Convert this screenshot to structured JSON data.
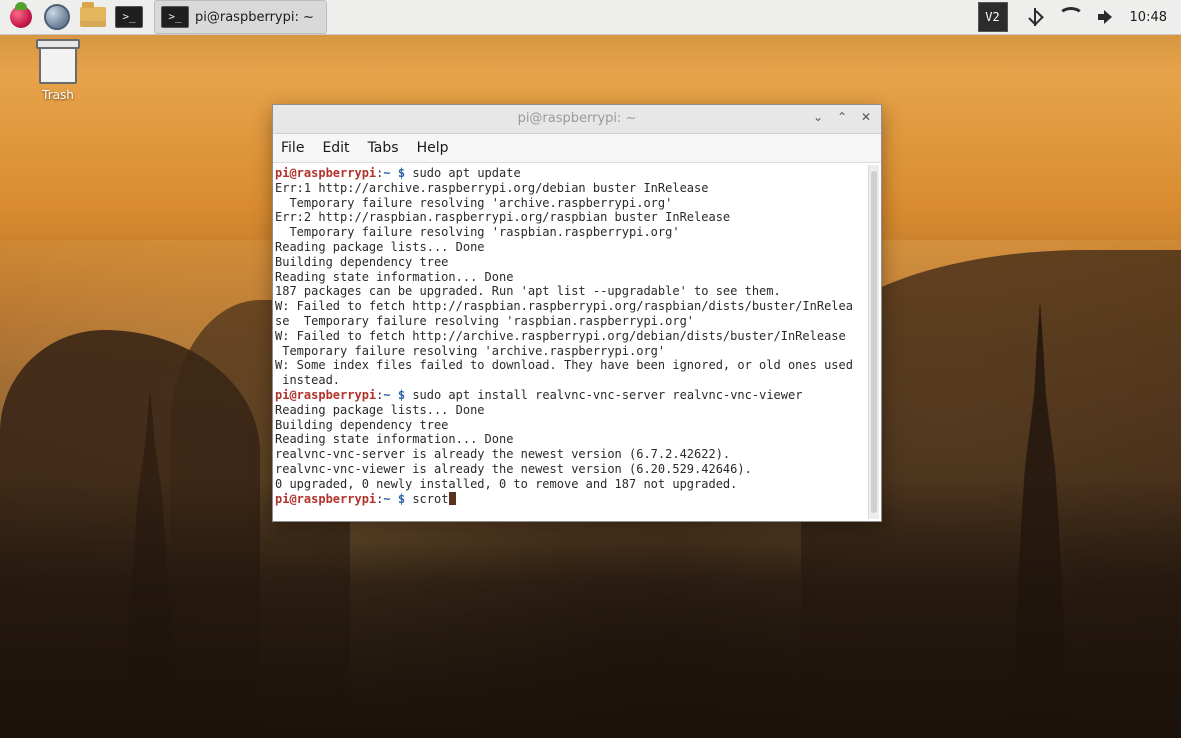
{
  "taskbar": {
    "active_task_label": "pi@raspberrypi: ~",
    "clock": "10:48",
    "vnc_icon_text": "V2"
  },
  "desktop": {
    "trash_label": "Trash"
  },
  "terminal_window": {
    "title": "pi@raspberrypi: ~",
    "menus": [
      "File",
      "Edit",
      "Tabs",
      "Help"
    ],
    "lines": [
      {
        "type": "prompt",
        "user": "pi@raspberrypi",
        "path": "~",
        "cmd": "sudo apt update"
      },
      {
        "type": "text",
        "text": "Err:1 http://archive.raspberrypi.org/debian buster InRelease"
      },
      {
        "type": "text",
        "text": "  Temporary failure resolving 'archive.raspberrypi.org'"
      },
      {
        "type": "text",
        "text": "Err:2 http://raspbian.raspberrypi.org/raspbian buster InRelease"
      },
      {
        "type": "text",
        "text": "  Temporary failure resolving 'raspbian.raspberrypi.org'"
      },
      {
        "type": "text",
        "text": "Reading package lists... Done"
      },
      {
        "type": "text",
        "text": "Building dependency tree"
      },
      {
        "type": "text",
        "text": "Reading state information... Done"
      },
      {
        "type": "text",
        "text": "187 packages can be upgraded. Run 'apt list --upgradable' to see them."
      },
      {
        "type": "text",
        "text": "W: Failed to fetch http://raspbian.raspberrypi.org/raspbian/dists/buster/InRelea"
      },
      {
        "type": "text",
        "text": "se  Temporary failure resolving 'raspbian.raspberrypi.org'"
      },
      {
        "type": "text",
        "text": "W: Failed to fetch http://archive.raspberrypi.org/debian/dists/buster/InRelease"
      },
      {
        "type": "text",
        "text": " Temporary failure resolving 'archive.raspberrypi.org'"
      },
      {
        "type": "text",
        "text": "W: Some index files failed to download. They have been ignored, or old ones used"
      },
      {
        "type": "text",
        "text": " instead."
      },
      {
        "type": "prompt",
        "user": "pi@raspberrypi",
        "path": "~",
        "cmd": "sudo apt install realvnc-vnc-server realvnc-vnc-viewer"
      },
      {
        "type": "text",
        "text": "Reading package lists... Done"
      },
      {
        "type": "text",
        "text": "Building dependency tree"
      },
      {
        "type": "text",
        "text": "Reading state information... Done"
      },
      {
        "type": "text",
        "text": "realvnc-vnc-server is already the newest version (6.7.2.42622)."
      },
      {
        "type": "text",
        "text": "realvnc-vnc-viewer is already the newest version (6.20.529.42646)."
      },
      {
        "type": "text",
        "text": "0 upgraded, 0 newly installed, 0 to remove and 187 not upgraded."
      },
      {
        "type": "prompt",
        "user": "pi@raspberrypi",
        "path": "~",
        "cmd": "scrot",
        "cursor": true
      }
    ]
  },
  "colors": {
    "prompt_user": "#b3322d",
    "prompt_path": "#2f62a6",
    "terminal_text": "#2a2a2a",
    "taskbar_bg": "#eeeeec"
  }
}
